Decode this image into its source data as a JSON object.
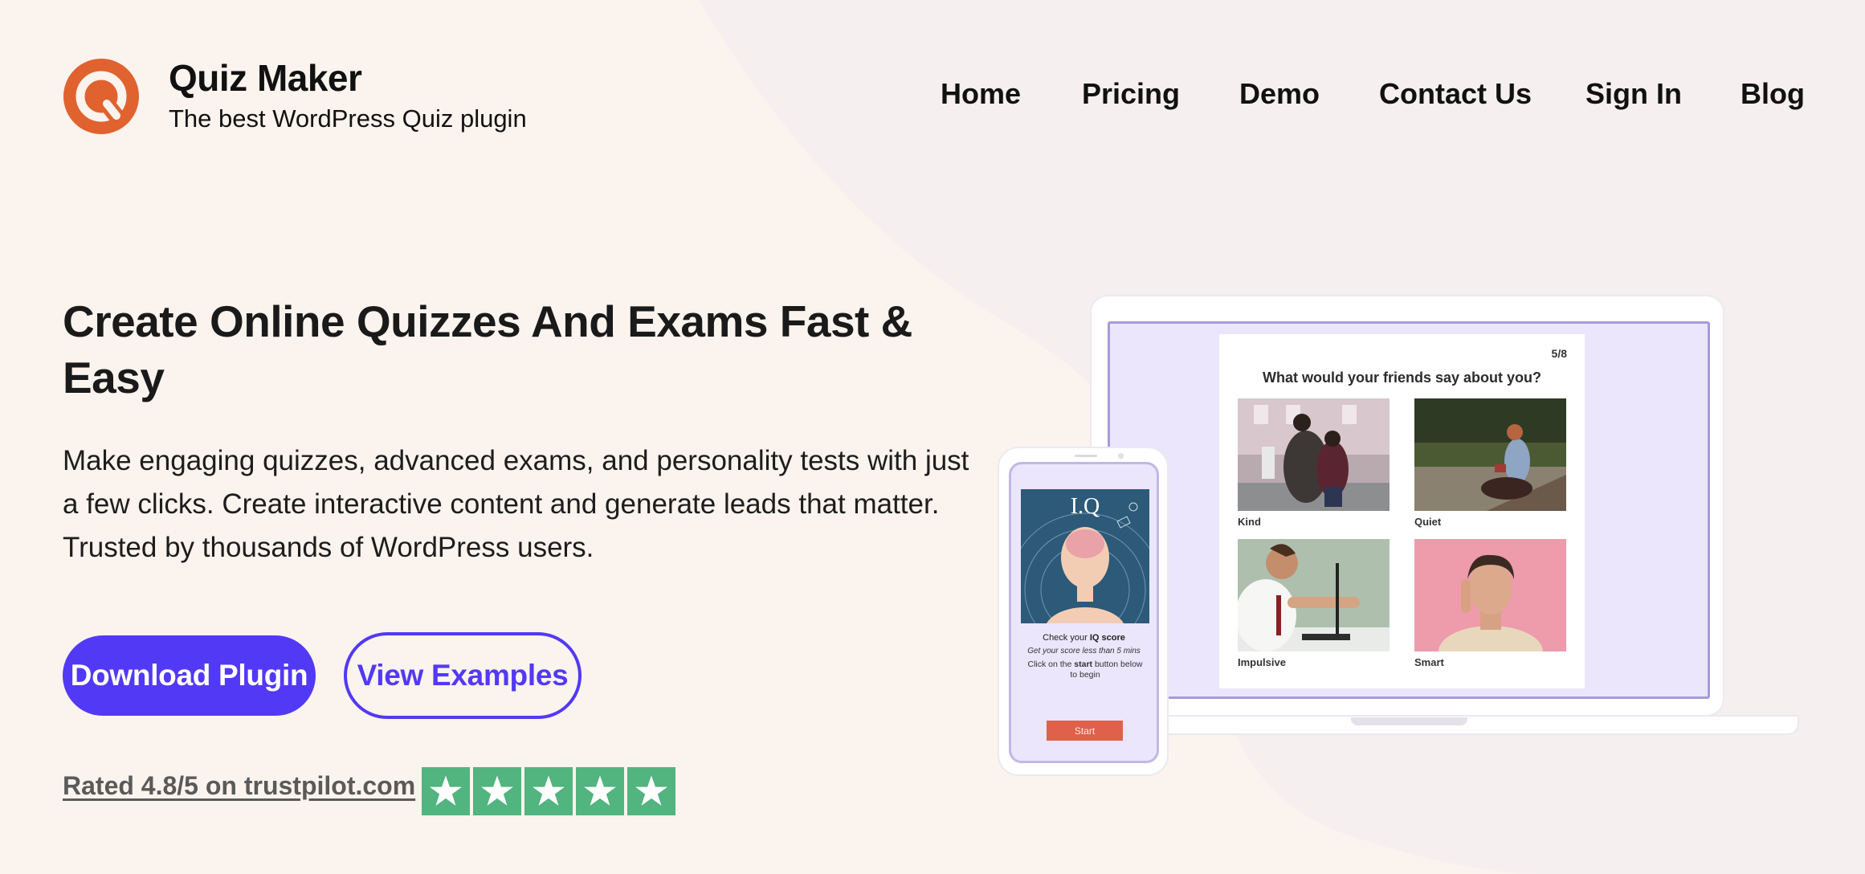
{
  "brand": {
    "title": "Quiz Maker",
    "subtitle": "The best WordPress Quiz plugin",
    "logo_icon": "quiz-maker-q-logo",
    "logo_color": "#e0622f"
  },
  "nav": {
    "items": [
      {
        "label": "Home"
      },
      {
        "label": "Pricing"
      },
      {
        "label": "Demo"
      },
      {
        "label": "Contact Us"
      },
      {
        "label": "Sign In"
      },
      {
        "label": "Blog"
      }
    ]
  },
  "hero": {
    "heading": "Create Online Quizzes And Exams Fast & Easy",
    "description": "Make engaging quizzes, advanced exams, and personality tests with just a few clicks. Create interactive content and generate leads that matter. Trusted by thousands of WordPress users.",
    "primary_button": "Download Plugin",
    "secondary_button": "View Examples",
    "accent_color": "#5239f5"
  },
  "rating": {
    "text": "Rated 4.8/5 on trustpilot.com",
    "stars": 5,
    "star_color": "#52b47f",
    "star_icon": "trustpilot-star-icon"
  },
  "laptop_quiz": {
    "counter": "5/8",
    "question": "What would your friends say about you?",
    "options": [
      {
        "label": "Kind"
      },
      {
        "label": "Quiet"
      },
      {
        "label": "Impulsive"
      },
      {
        "label": "Smart"
      }
    ]
  },
  "phone_quiz": {
    "image_title": "I.Q",
    "line1_prefix": "Check your ",
    "line1_bold": "IQ score",
    "line2": "Get your score less than 5 mins",
    "line3_prefix": "Click on the ",
    "line3_bold": "start",
    "line3_suffix": " button below to begin",
    "start_button": "Start",
    "start_color": "#df6149"
  }
}
